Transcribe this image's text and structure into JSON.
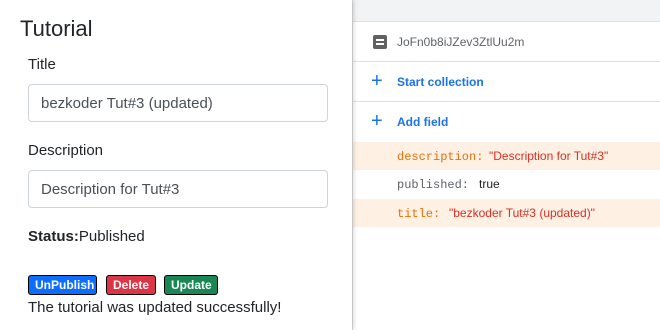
{
  "form": {
    "title": "Tutorial",
    "title_label": "Title",
    "title_value": "bezkoder Tut#3 (updated)",
    "description_label": "Description",
    "description_value": "Description for Tut#3",
    "status_label": "Status:",
    "status_value": "Published",
    "buttons": {
      "unpublish": "UnPublish",
      "delete": "Delete",
      "update": "Update"
    },
    "message": "The tutorial was updated successfully!"
  },
  "firestore": {
    "document_id": "JoFn0b8iJZev3ZtlUu2m",
    "start_collection": "Start collection",
    "add_field": "Add field",
    "fields": [
      {
        "key": "description:",
        "value": "\"Description for Tut#3\"",
        "highlight": true
      },
      {
        "key": "published:",
        "value": "true",
        "highlight": false
      },
      {
        "key": "title:",
        "value": "\"bezkoder Tut#3 (updated)\"",
        "highlight": true
      }
    ]
  },
  "colors": {
    "unpublish": "#0d6efd",
    "delete": "#dc3545",
    "update": "#198754",
    "firestore_accent": "#1a73e8",
    "changed_highlight": "#fef0e3"
  }
}
